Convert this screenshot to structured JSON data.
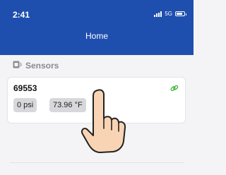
{
  "status_bar": {
    "time": "2:41",
    "network": "5G"
  },
  "header": {
    "title": "Home"
  },
  "sections": {
    "sensors": {
      "title": "Sensors",
      "icon": "sensor-icon",
      "cards": [
        {
          "id": "69553",
          "readings": {
            "pressure": "0 psi",
            "temperature": "73.96 °F"
          },
          "link_icon": "link-icon"
        }
      ]
    }
  },
  "colors": {
    "header_bg": "#1f4fae",
    "link_green": "#3fb436",
    "badge_bg": "#d8d8dc",
    "page_bg": "#f4f4f6"
  }
}
